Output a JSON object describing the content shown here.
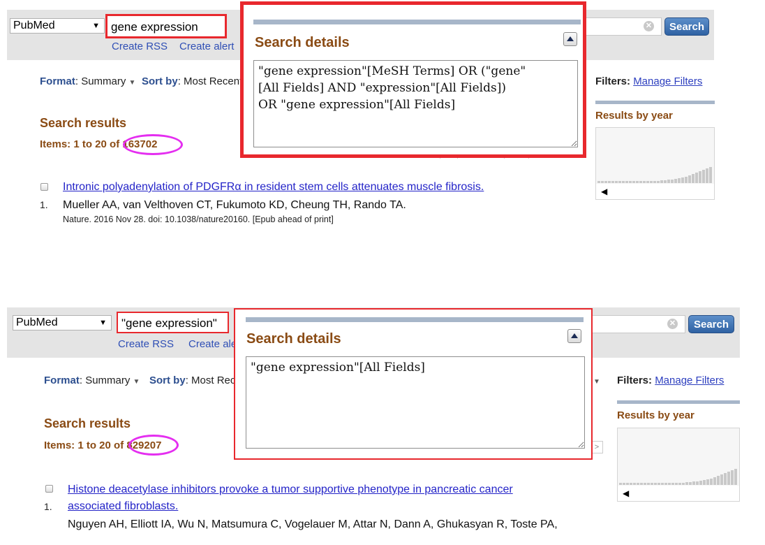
{
  "panels": [
    {
      "database": "PubMed",
      "query": "gene expression",
      "links": {
        "create_rss": "Create RSS",
        "create_alert": "Create alert"
      },
      "search_button": "Search",
      "format_label": "Format",
      "format_value": "Summary",
      "sort_label": "Sort by",
      "sort_value": "Most Recent",
      "filters_label": "Filters:",
      "manage_filters": "Manage Filters",
      "results_by_year": "Results by year",
      "results_heading": "Search results",
      "items_prefix": "Items: 1 to 20 of",
      "items_total": "163702",
      "details": {
        "title": "Search details",
        "text": "\"gene expression\"[MeSH Terms] OR (\"gene\"\n[All Fields] AND \"expression\"[All Fields])\nOR \"gene expression\"[All Fields]"
      },
      "result": {
        "number": "1.",
        "title": "Intronic polyadenylation of PDGFRα in resident stem cells attenuates muscle fibrosis.",
        "authors": "Mueller AA, van Velthoven CT, Fukumoto KD, Cheung TH, Rando TA.",
        "citation": "Nature. 2016 Nov 28. doi: 10.1038/nature20160. [Epub ahead of print]"
      }
    },
    {
      "database": "PubMed",
      "query": "\"gene expression\"",
      "links": {
        "create_rss": "Create RSS",
        "create_alert": "Create ale"
      },
      "search_button": "Search",
      "format_label": "Format",
      "format_value": "Summary",
      "sort_label": "Sort by",
      "sort_value": "Most Rec",
      "filters_label": "Filters:",
      "manage_filters": "Manage Filters",
      "results_by_year": "Results by year",
      "results_heading": "Search results",
      "items_prefix": "Items: 1 to 20 of",
      "items_total": "829207",
      "details": {
        "title": "Search details",
        "text": "\"gene expression\"[All Fields]"
      },
      "result": {
        "number": "1.",
        "title_line1": "Histone deacetylase inhibitors provoke a tumor supportive phenotype in pancreatic cancer",
        "title_line2": "associated fibroblasts.",
        "authors": "Nguyen AH, Elliott IA, Wu N, Matsumura C, Vogelauer M, Attar N, Dann A, Ghukasyan R, Toste PA,"
      }
    }
  ],
  "icons": {
    "clear": "clear-x-icon",
    "collapse": "chevron-up-icon",
    "scroll_left": "triangle-left-icon",
    "dropdown": "caret-down-icon"
  },
  "colors": {
    "highlight_box": "#e8282d",
    "count_oval": "#e42ef0",
    "heading_brown": "#8a4b14",
    "link_blue": "#2424c8",
    "search_button": "#3a6fb0"
  }
}
